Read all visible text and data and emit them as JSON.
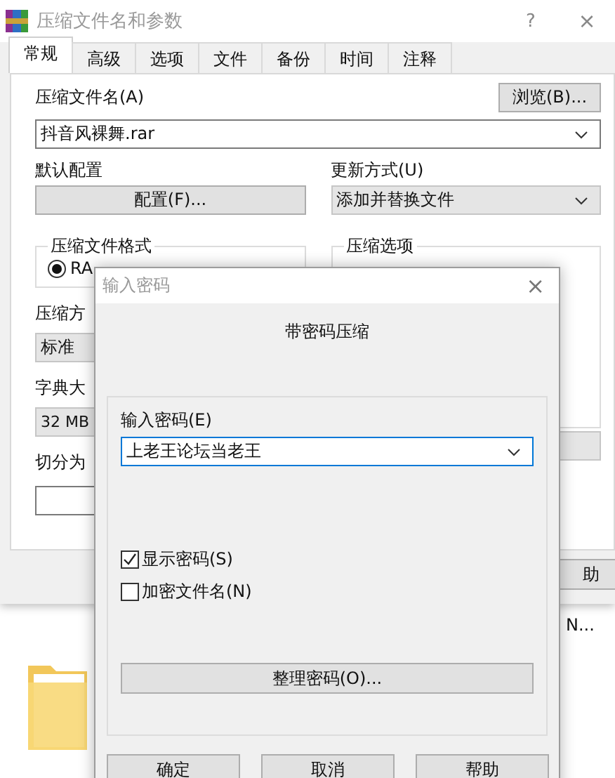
{
  "window": {
    "title": "压缩文件名和参数",
    "help": "?",
    "close": "×"
  },
  "tabs": [
    {
      "label": "常规",
      "selected": true
    },
    {
      "label": "高级",
      "selected": false
    },
    {
      "label": "选项",
      "selected": false
    },
    {
      "label": "文件",
      "selected": false
    },
    {
      "label": "备份",
      "selected": false
    },
    {
      "label": "时间",
      "selected": false
    },
    {
      "label": "注释",
      "selected": false
    }
  ],
  "general": {
    "archive_name_label": "压缩文件名(A)",
    "browse_button": "浏览(B)...",
    "archive_name": "抖音风裸舞.rar",
    "profile_label": "默认配置",
    "profile_button": "配置(F)...",
    "update_label": "更新方式(U)",
    "update_mode": "添加并替换文件",
    "format_group": "压缩文件格式",
    "format_option": {
      "label": "RA",
      "selected": true
    },
    "options_group": "压缩选项",
    "method_label": "压缩方",
    "method": "标准",
    "dict_label": "字典大",
    "dict": "32 MB",
    "split_label": "切分为"
  },
  "back_help_button": "助",
  "desktop": {
    "label": "N..."
  },
  "dialog": {
    "title": "输入密码",
    "close": "×",
    "heading": "带密码压缩",
    "password_label": "输入密码(E)",
    "password": "上老王论坛当老王",
    "checkboxes": [
      {
        "label": "显示密码(S)",
        "checked": true
      },
      {
        "label": "加密文件名(N)",
        "checked": false
      }
    ],
    "organize_button": "整理密码(O)...",
    "buttons": [
      "确定",
      "取消",
      "帮助"
    ]
  }
}
